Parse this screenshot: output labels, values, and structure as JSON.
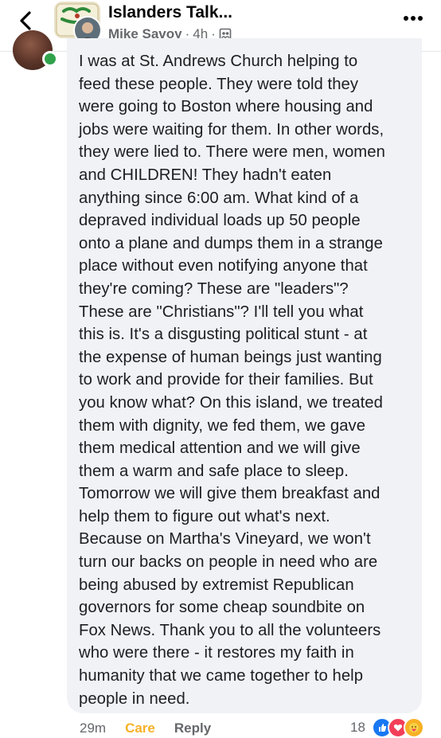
{
  "header": {
    "group_name": "Islanders Talk...",
    "author": "Mike Savoy",
    "separator": "·",
    "time": "4h",
    "separator2": "·",
    "privacy_icon": "group-members-icon",
    "back_icon": "back-chevron-icon",
    "more_icon": "more-dots-icon"
  },
  "comment": {
    "text": "I was at St. Andrews Church helping to\nfeed these people. They were told they\nwere going to Boston where housing and\njobs were waiting for them. In other words,\nthey were lied to. There were men, women\nand CHILDREN! They hadn't eaten\nanything since 6:00 am. What kind of a\ndepraved individual loads up 50 people\nonto a plane and dumps them in a strange\nplace without even notifying anyone that\nthey're coming? These are \"leaders\"?\nThese are \"Christians\"? I'll tell you what\nthis is. It's a disgusting political stunt - at\nthe expense of human beings just wanting\nto work and provide for their families. But\nyou know what? On this island, we treated\nthem with dignity, we fed them, we gave\nthem medical attention and we will give\nthem a warm and safe place to sleep.\nTomorrow we will give them breakfast and\nhelp them to figure out what's next.\nBecause on Martha's Vineyard, we won't\nturn our backs on people in need who are\nbeing abused by extremist Republican\ngovernors for some cheap soundbite on\nFox News. Thank you to all the volunteers\nwho were there - it restores my faith in\nhumanity that we came together to help\npeople in need.",
    "online_color": "#31a24c"
  },
  "actions": {
    "time": "29m",
    "care": "Care",
    "reply": "Reply",
    "reaction_count": "18",
    "reaction_icons": [
      "like-icon",
      "love-icon",
      "care-icon"
    ]
  },
  "colors": {
    "bubble": "#f0f2f5",
    "text": "#1c1e21",
    "meta": "#65676b",
    "care": "#f7b125",
    "like": "#1877f2",
    "love": "#f33e58"
  }
}
